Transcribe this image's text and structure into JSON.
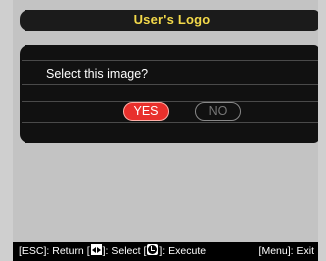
{
  "header": {
    "title": "User's Logo"
  },
  "dialog": {
    "prompt": "Select this image?",
    "yes_label": "YES",
    "no_label": "NO"
  },
  "footer": {
    "esc_text": "[ESC]: Return [",
    "select_text": "]: Select [",
    "execute_text": "]: Execute",
    "menu_text": "[Menu]: Exit"
  },
  "icons": {
    "select": "left-right-arrows-icon",
    "execute": "enter-icon"
  },
  "colors": {
    "title_text": "#f3d94a",
    "yes_button": "#e8302c",
    "panel": "#111111",
    "background": "#c3c3c3"
  }
}
